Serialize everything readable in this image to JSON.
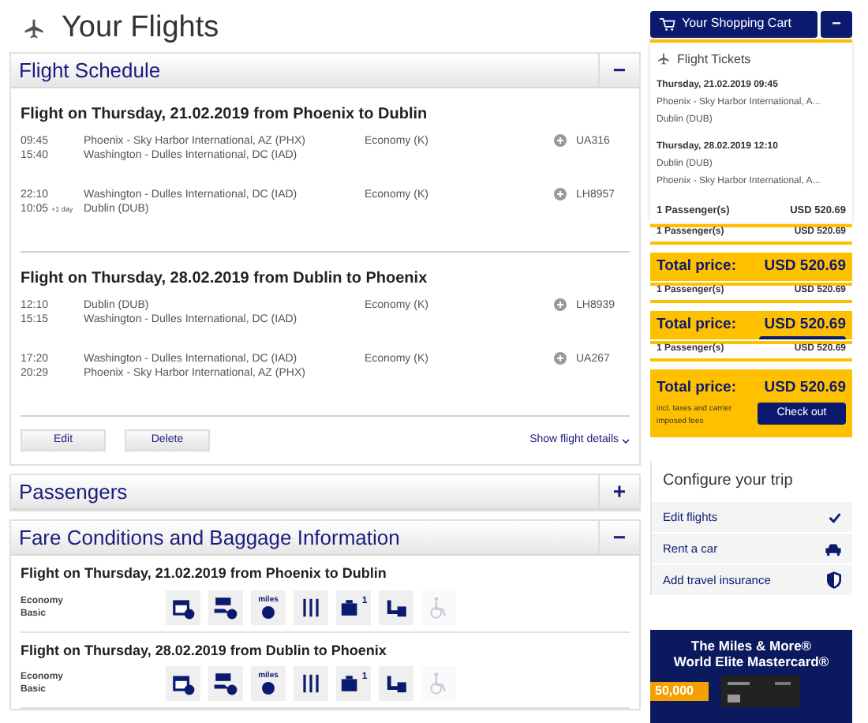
{
  "page_title": "Your Flights",
  "sections": [
    {
      "kind": "schedule",
      "title": "Flight Schedule",
      "toggle": "−",
      "flights": [
        {
          "heading": "Flight on Thursday, 21.02.2019 from Phoenix to Dublin",
          "segments": [
            {
              "dep_time": "09:45",
              "arr_time": "15:40",
              "from": "Phoenix - Sky Harbor International, AZ (PHX)",
              "to": "Washington - Dulles International, DC (IAD)",
              "cabin": "Economy (K)",
              "flight_no": "UA316"
            },
            {
              "dep_time": "22:10",
              "arr_time": "10:05",
              "arr_note": "+1 day",
              "from": "Washington - Dulles International, DC (IAD)",
              "to": "Dublin (DUB)",
              "cabin": "Economy (K)",
              "flight_no": "LH8957"
            }
          ]
        },
        {
          "heading": "Flight on Thursday, 28.02.2019 from Dublin to Phoenix",
          "segments": [
            {
              "dep_time": "12:10",
              "arr_time": "15:15",
              "from": "Dublin (DUB)",
              "to": "Washington - Dulles International, DC (IAD)",
              "cabin": "Economy (K)",
              "flight_no": "LH8939"
            },
            {
              "dep_time": "17:20",
              "arr_time": "20:29",
              "from": "Washington - Dulles International, DC (IAD)",
              "to": "Phoenix - Sky Harbor International, AZ (PHX)",
              "cabin": "Economy (K)",
              "flight_no": "UA267"
            }
          ]
        }
      ],
      "buttons": [
        "Edit",
        "Delete"
      ],
      "details_link": "Show flight details"
    },
    {
      "kind": "passengers",
      "title": "Passengers",
      "toggle": "+"
    },
    {
      "kind": "fares",
      "title": "Fare Conditions and Baggage Information",
      "toggle": "−",
      "flights": [
        {
          "heading": "Flight on Thursday, 21.02.2019 from Phoenix to Dublin",
          "fare_lines": [
            "Economy",
            "Basic"
          ],
          "icons": [
            {
              "kind": "calendar",
              "disabled": false
            },
            {
              "kind": "refund",
              "disabled": false
            },
            {
              "kind": "miles",
              "label": "miles",
              "disabled": false
            },
            {
              "kind": "meal",
              "disabled": false
            },
            {
              "kind": "bag",
              "label": "1",
              "disabled": false
            },
            {
              "kind": "seat",
              "disabled": false
            },
            {
              "kind": "wheelchair",
              "disabled": true
            }
          ]
        },
        {
          "heading": "Flight on Thursday, 28.02.2019 from Dublin to Phoenix",
          "fare_lines": [
            "Economy",
            "Basic"
          ],
          "icons": [
            {
              "kind": "calendar",
              "disabled": false
            },
            {
              "kind": "refund",
              "disabled": false
            },
            {
              "kind": "miles",
              "label": "miles",
              "disabled": false
            },
            {
              "kind": "meal",
              "disabled": false
            },
            {
              "kind": "bag",
              "label": "1",
              "disabled": false
            },
            {
              "kind": "seat",
              "disabled": false
            },
            {
              "kind": "wheelchair",
              "disabled": true
            }
          ]
        }
      ]
    }
  ],
  "cart": {
    "title": "Your Shopping Cart",
    "toggle": "−",
    "section_title": "Flight Tickets",
    "tickets": [
      {
        "date": "Thursday, 21.02.2019 09:45",
        "lines": [
          "Phoenix - Sky Harbor International, A...",
          "Dublin (DUB)"
        ]
      },
      {
        "date": "Thursday, 28.02.2019 12:10",
        "lines": [
          "Dublin (DUB)",
          "Phoenix - Sky Harbor International, A..."
        ]
      }
    ],
    "passengers": "1 Passenger(s)",
    "price": "USD 520.69",
    "layers": [
      {
        "kind": "ghost",
        "passengers": "1 Passenger(s)",
        "price": "USD 520.69"
      },
      {
        "kind": "total",
        "label": "Total price:",
        "amount": "USD 520.69"
      },
      {
        "kind": "ghost",
        "passengers": "1 Passenger(s)",
        "price": "USD 520.69"
      },
      {
        "kind": "total",
        "label": "Total price:",
        "amount": "USD 520.69",
        "button_sliver": true
      },
      {
        "kind": "ghost",
        "passengers": "1 Passenger(s)",
        "price": "USD 520.69"
      },
      {
        "kind": "final",
        "label": "Total price:",
        "amount": "USD 520.69",
        "note": "incl. taxes and carrier imposed fees",
        "button": "Check out"
      }
    ]
  },
  "configure": {
    "title": "Configure your trip",
    "items": [
      {
        "label": "Edit flights",
        "kind": "check"
      },
      {
        "label": "Rent a car",
        "kind": "car"
      },
      {
        "label": "Add travel insurance",
        "kind": "shield"
      }
    ]
  },
  "ad": {
    "lines": [
      "The Miles & More®",
      "World Elite Mastercard®"
    ],
    "tag": "50,000"
  }
}
